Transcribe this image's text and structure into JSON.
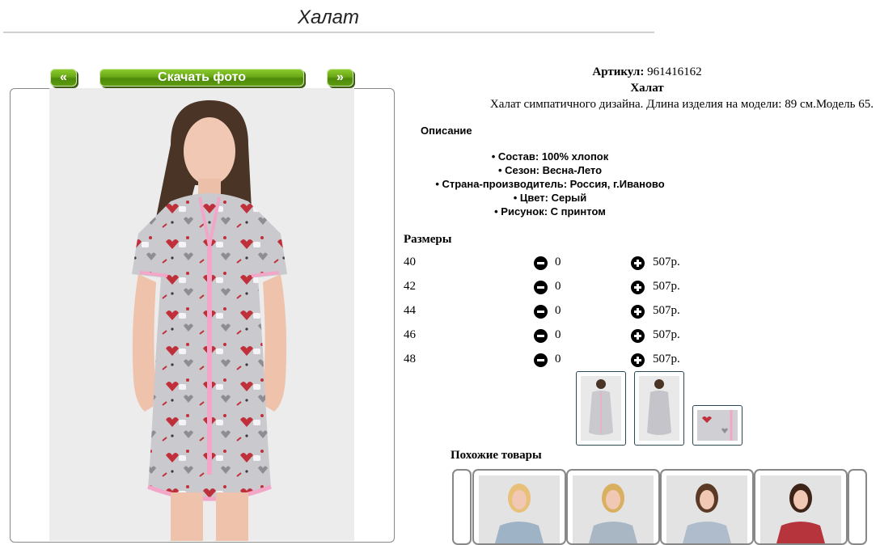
{
  "page": {
    "title": "Халат"
  },
  "gallery": {
    "prev_label": "«",
    "download_label": "Скачать фото",
    "next_label": "»"
  },
  "product": {
    "sku_label": "Артикул:",
    "sku_value": "961416162",
    "name": "Халат",
    "description": "Халат симпатичного дизайна. Длина изделия на модели: 89 см.Модель 65.",
    "description_heading": "Описание",
    "features": [
      "Состав: 100% хлопок",
      "Сезон: Весна-Лето",
      "Страна-производитель: Россия, г.Иваново",
      "Цвет: Серый",
      "Рисунок: С принтом"
    ]
  },
  "sizes": {
    "heading": "Размеры",
    "rows": [
      {
        "size": "40",
        "qty": "0",
        "price": "507р."
      },
      {
        "size": "42",
        "qty": "0",
        "price": "507р."
      },
      {
        "size": "44",
        "qty": "0",
        "price": "507р."
      },
      {
        "size": "46",
        "qty": "0",
        "price": "507р."
      },
      {
        "size": "48",
        "qty": "0",
        "price": "507р."
      }
    ]
  },
  "similar": {
    "heading": "Похожие товары"
  },
  "colors": {
    "button_green": "#6aa816",
    "robe_gray": "#c8c8cc",
    "trim_pink": "#f2a7c8",
    "print_red": "#c0303a"
  }
}
